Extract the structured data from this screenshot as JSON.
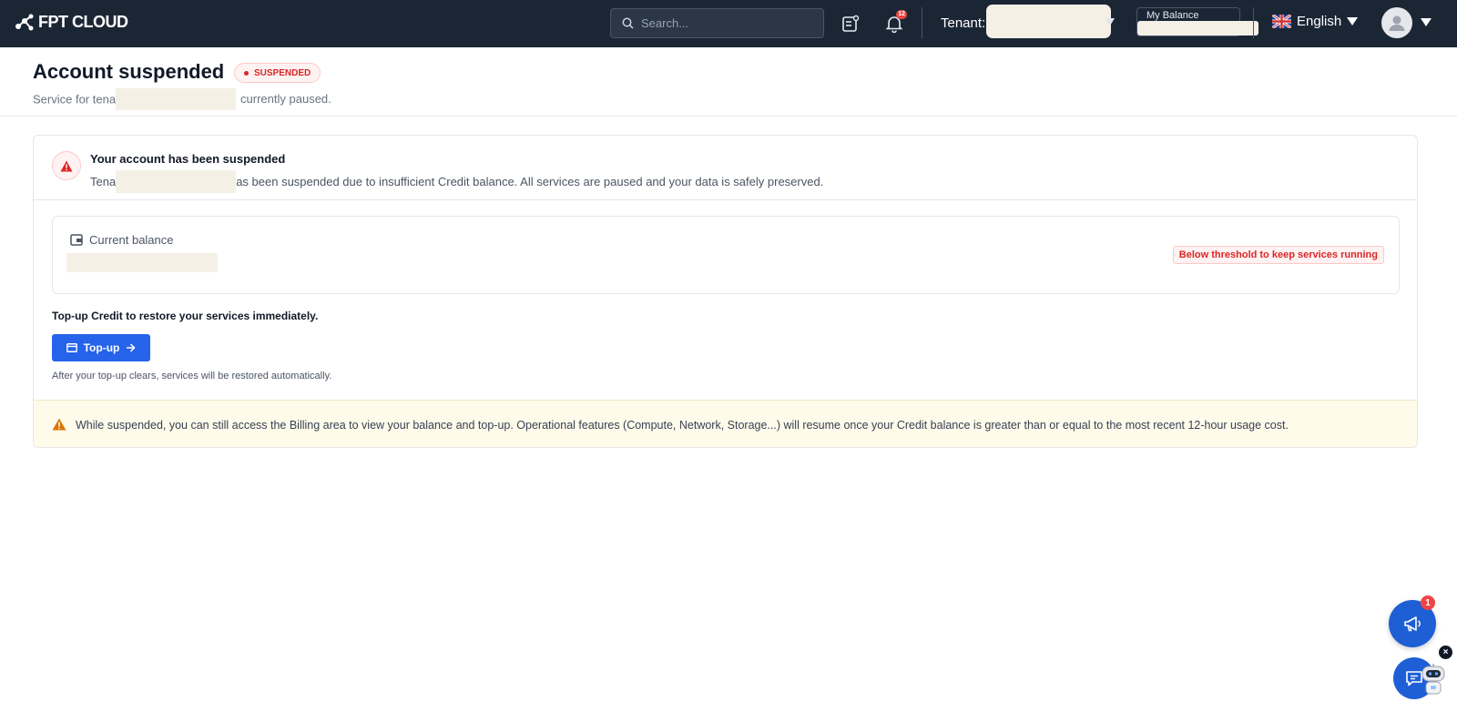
{
  "header": {
    "logo_text": "FPT CLOUD",
    "search_placeholder": "Search...",
    "notification_count": "12",
    "tenant_label": "Tenant:",
    "balance_label": "My Balance",
    "language": "English"
  },
  "page": {
    "title": "Account suspended",
    "status_badge": "SUSPENDED",
    "subtitle_prefix": "Service for tena",
    "subtitle_suffix": "currently paused."
  },
  "alert": {
    "title": "Your account has been suspended",
    "text_prefix": "Tena",
    "text_suffix": "as been suspended due to insufficient Credit balance. All services are paused and your data is safely preserved."
  },
  "balance": {
    "label": "Current balance",
    "threshold_badge": "Below threshold to keep services running"
  },
  "topup": {
    "hint": "Top-up Credit to restore your services immediately.",
    "button_label": "Top-up",
    "note": "After your top-up clears, services will be restored automatically."
  },
  "warning": {
    "text": "While suspended, you can still access the Billing area to view your balance and top-up. Operational features (Compute, Network, Storage...) will resume once your Credit balance is greater than or equal to the most recent 12-hour usage cost."
  },
  "fab": {
    "announce_badge": "1",
    "close": "×"
  },
  "colors": {
    "topbar": "#1b2635",
    "primary": "#2563eb",
    "danger": "#dc2626",
    "warning_bg": "#fffbeb"
  }
}
